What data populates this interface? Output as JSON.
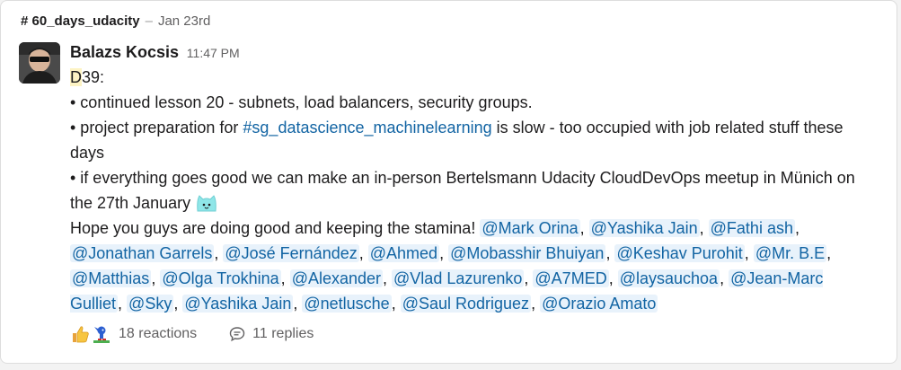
{
  "header": {
    "channel": "# 60_days_udacity",
    "separator": "–",
    "date": "Jan 23rd"
  },
  "message": {
    "author": "Balazs Kocsis",
    "time": "11:47 PM",
    "day_prefix": "D",
    "day_rest": "39:",
    "bullet1": "• continued lesson 20 - subnets, load balancers, security groups.",
    "bullet2_a": "• project preparation for ",
    "bullet2_channel": "#sg_datascience_machinelearning",
    "bullet2_b": " is slow - too occupied with job related stuff these days",
    "bullet3": "• if everything goes good we can make an in-person Bertelsmann Udacity CloudDevOps meetup in Münich on the 27th January ",
    "closing": "Hope you guys are doing good and keeping the stamina! ",
    "mentions": [
      "@Mark Orina",
      "@Yashika Jain",
      "@Fathi ash",
      "@Jonathan Garrels",
      "@José Fernández",
      "@Ahmed",
      "@Mobasshir Bhuiyan",
      "@Keshav Purohit",
      "@Mr. B.E",
      "@Matthias",
      "@Olga Trokhina",
      "@Alexander",
      "@Vlad Lazurenko",
      "@A7MED",
      "@laysauchoa",
      "@Jean-Marc Gulliet",
      "@Sky",
      "@Yashika Jain",
      "@netlusche",
      "@Saul Rodriguez",
      "@Orazio Amato"
    ]
  },
  "footer": {
    "reaction_icons": [
      "thumbs-up-icon",
      "sonic-icon"
    ],
    "reactions_label": "18 reactions",
    "replies_label": "11 replies"
  },
  "colors": {
    "link": "#1264a3",
    "mention_bg": "#e8f2fb",
    "highlight": "#fdf3c4"
  }
}
